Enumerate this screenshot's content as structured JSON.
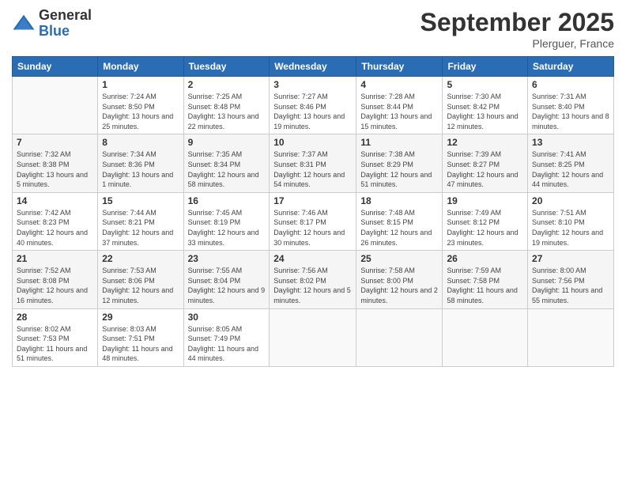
{
  "header": {
    "logo_general": "General",
    "logo_blue": "Blue",
    "main_title": "September 2025",
    "subtitle": "Plerguer, France"
  },
  "columns": [
    "Sunday",
    "Monday",
    "Tuesday",
    "Wednesday",
    "Thursday",
    "Friday",
    "Saturday"
  ],
  "weeks": [
    {
      "days": [
        {
          "number": "",
          "info": ""
        },
        {
          "number": "1",
          "info": "Sunrise: 7:24 AM\nSunset: 8:50 PM\nDaylight: 13 hours and 25 minutes."
        },
        {
          "number": "2",
          "info": "Sunrise: 7:25 AM\nSunset: 8:48 PM\nDaylight: 13 hours and 22 minutes."
        },
        {
          "number": "3",
          "info": "Sunrise: 7:27 AM\nSunset: 8:46 PM\nDaylight: 13 hours and 19 minutes."
        },
        {
          "number": "4",
          "info": "Sunrise: 7:28 AM\nSunset: 8:44 PM\nDaylight: 13 hours and 15 minutes."
        },
        {
          "number": "5",
          "info": "Sunrise: 7:30 AM\nSunset: 8:42 PM\nDaylight: 13 hours and 12 minutes."
        },
        {
          "number": "6",
          "info": "Sunrise: 7:31 AM\nSunset: 8:40 PM\nDaylight: 13 hours and 8 minutes."
        }
      ]
    },
    {
      "days": [
        {
          "number": "7",
          "info": "Sunrise: 7:32 AM\nSunset: 8:38 PM\nDaylight: 13 hours and 5 minutes."
        },
        {
          "number": "8",
          "info": "Sunrise: 7:34 AM\nSunset: 8:36 PM\nDaylight: 13 hours and 1 minute."
        },
        {
          "number": "9",
          "info": "Sunrise: 7:35 AM\nSunset: 8:34 PM\nDaylight: 12 hours and 58 minutes."
        },
        {
          "number": "10",
          "info": "Sunrise: 7:37 AM\nSunset: 8:31 PM\nDaylight: 12 hours and 54 minutes."
        },
        {
          "number": "11",
          "info": "Sunrise: 7:38 AM\nSunset: 8:29 PM\nDaylight: 12 hours and 51 minutes."
        },
        {
          "number": "12",
          "info": "Sunrise: 7:39 AM\nSunset: 8:27 PM\nDaylight: 12 hours and 47 minutes."
        },
        {
          "number": "13",
          "info": "Sunrise: 7:41 AM\nSunset: 8:25 PM\nDaylight: 12 hours and 44 minutes."
        }
      ]
    },
    {
      "days": [
        {
          "number": "14",
          "info": "Sunrise: 7:42 AM\nSunset: 8:23 PM\nDaylight: 12 hours and 40 minutes."
        },
        {
          "number": "15",
          "info": "Sunrise: 7:44 AM\nSunset: 8:21 PM\nDaylight: 12 hours and 37 minutes."
        },
        {
          "number": "16",
          "info": "Sunrise: 7:45 AM\nSunset: 8:19 PM\nDaylight: 12 hours and 33 minutes."
        },
        {
          "number": "17",
          "info": "Sunrise: 7:46 AM\nSunset: 8:17 PM\nDaylight: 12 hours and 30 minutes."
        },
        {
          "number": "18",
          "info": "Sunrise: 7:48 AM\nSunset: 8:15 PM\nDaylight: 12 hours and 26 minutes."
        },
        {
          "number": "19",
          "info": "Sunrise: 7:49 AM\nSunset: 8:12 PM\nDaylight: 12 hours and 23 minutes."
        },
        {
          "number": "20",
          "info": "Sunrise: 7:51 AM\nSunset: 8:10 PM\nDaylight: 12 hours and 19 minutes."
        }
      ]
    },
    {
      "days": [
        {
          "number": "21",
          "info": "Sunrise: 7:52 AM\nSunset: 8:08 PM\nDaylight: 12 hours and 16 minutes."
        },
        {
          "number": "22",
          "info": "Sunrise: 7:53 AM\nSunset: 8:06 PM\nDaylight: 12 hours and 12 minutes."
        },
        {
          "number": "23",
          "info": "Sunrise: 7:55 AM\nSunset: 8:04 PM\nDaylight: 12 hours and 9 minutes."
        },
        {
          "number": "24",
          "info": "Sunrise: 7:56 AM\nSunset: 8:02 PM\nDaylight: 12 hours and 5 minutes."
        },
        {
          "number": "25",
          "info": "Sunrise: 7:58 AM\nSunset: 8:00 PM\nDaylight: 12 hours and 2 minutes."
        },
        {
          "number": "26",
          "info": "Sunrise: 7:59 AM\nSunset: 7:58 PM\nDaylight: 11 hours and 58 minutes."
        },
        {
          "number": "27",
          "info": "Sunrise: 8:00 AM\nSunset: 7:56 PM\nDaylight: 11 hours and 55 minutes."
        }
      ]
    },
    {
      "days": [
        {
          "number": "28",
          "info": "Sunrise: 8:02 AM\nSunset: 7:53 PM\nDaylight: 11 hours and 51 minutes."
        },
        {
          "number": "29",
          "info": "Sunrise: 8:03 AM\nSunset: 7:51 PM\nDaylight: 11 hours and 48 minutes."
        },
        {
          "number": "30",
          "info": "Sunrise: 8:05 AM\nSunset: 7:49 PM\nDaylight: 11 hours and 44 minutes."
        },
        {
          "number": "",
          "info": ""
        },
        {
          "number": "",
          "info": ""
        },
        {
          "number": "",
          "info": ""
        },
        {
          "number": "",
          "info": ""
        }
      ]
    }
  ]
}
